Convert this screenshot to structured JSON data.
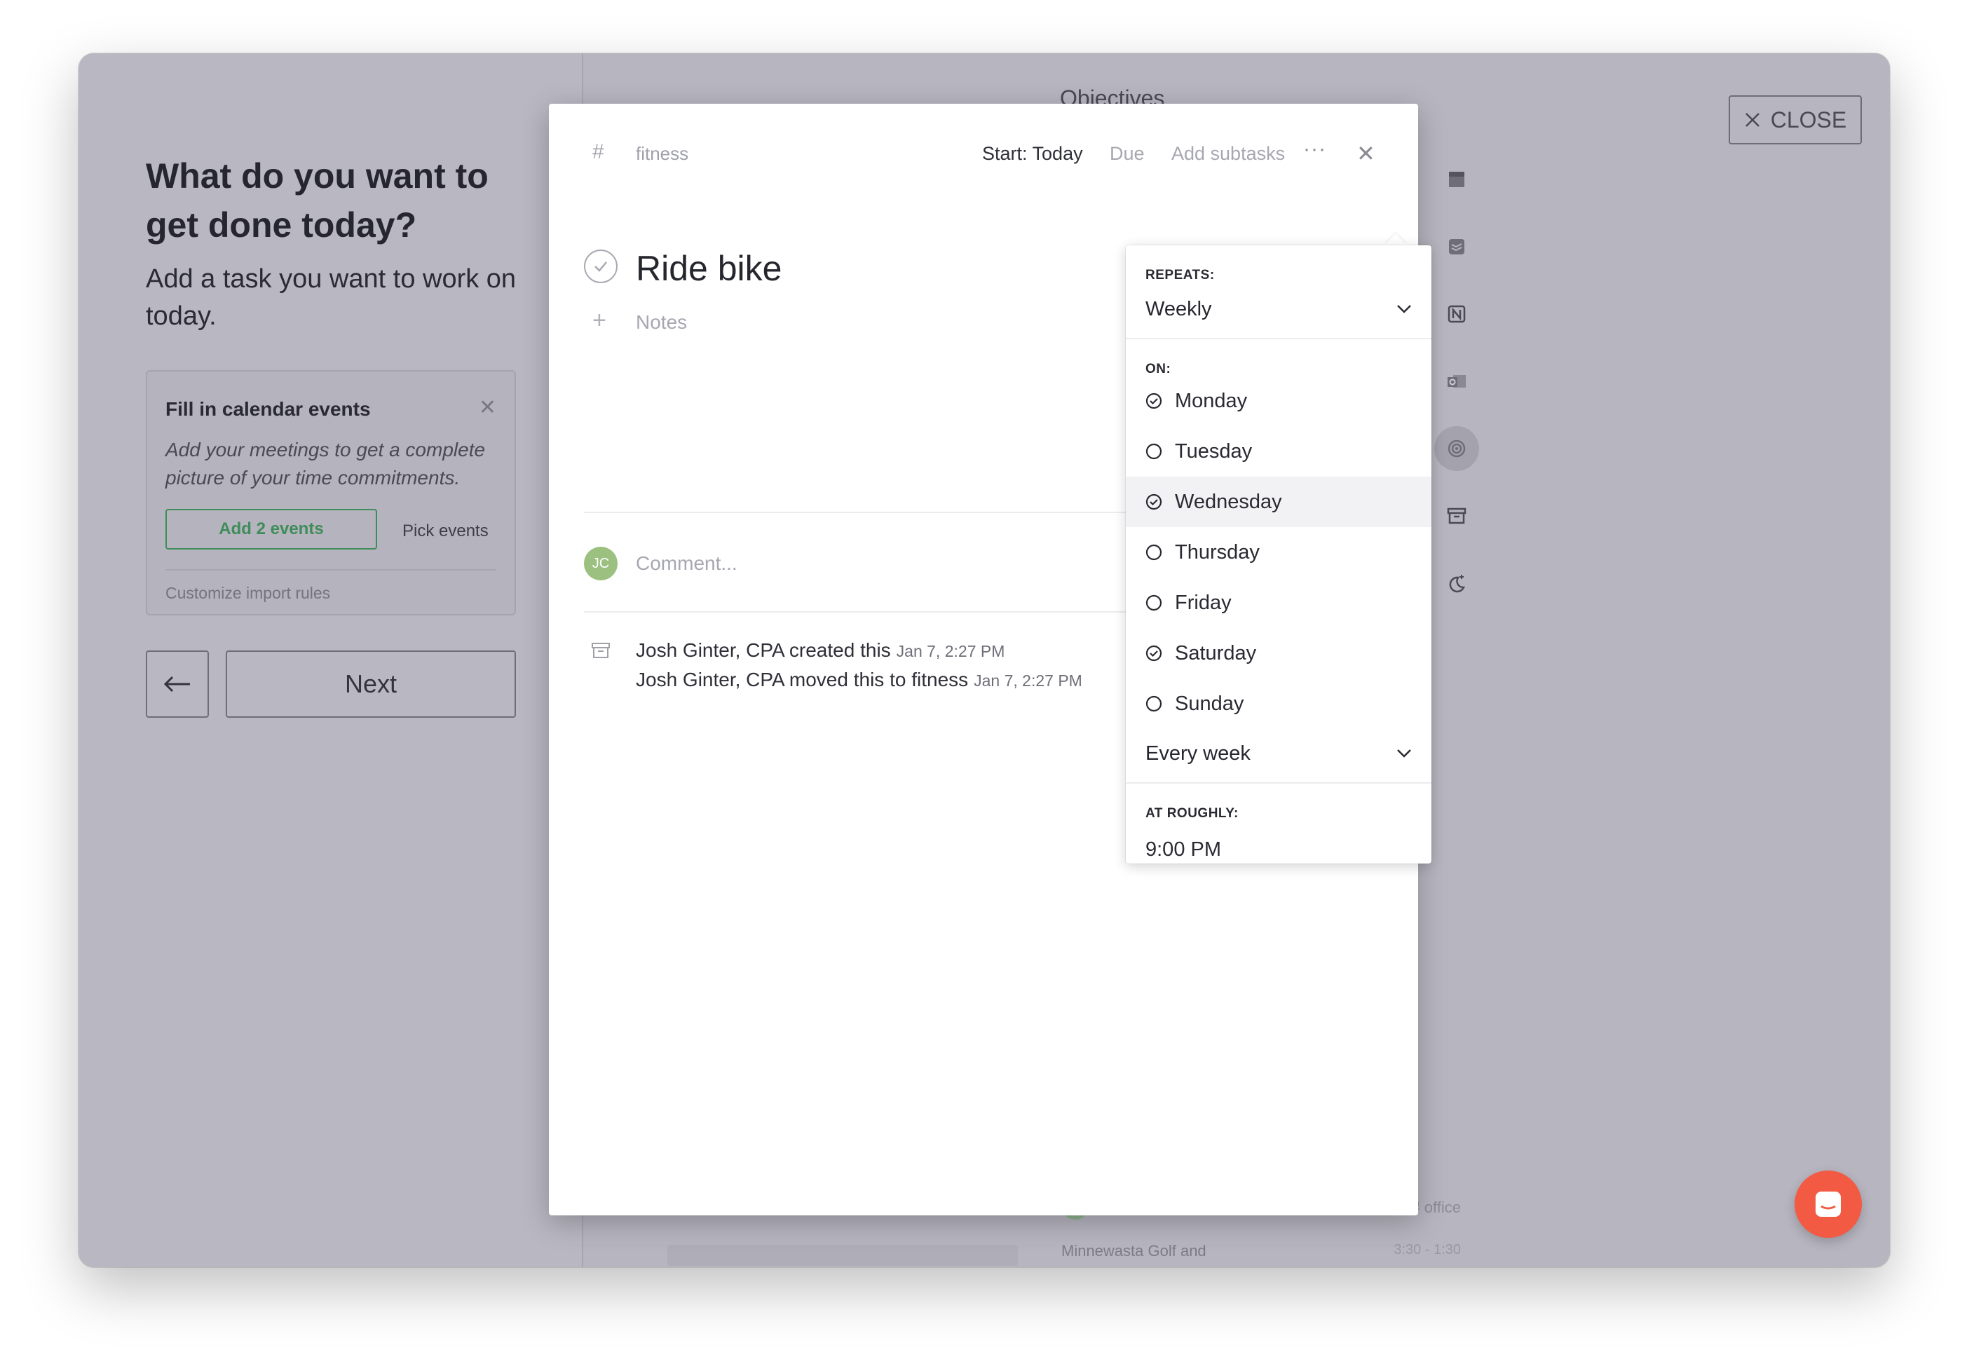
{
  "left": {
    "title": "What do you want to get done today?",
    "subtitle": "Add a task you want to work on today.",
    "calendar_card": {
      "title": "Fill in calendar events",
      "description": "Add your meetings to get a complete picture of your time commitments.",
      "add_events_label": "Add 2 events",
      "pick_events_label": "Pick events",
      "customize_label": "Customize import rules"
    },
    "next_label": "Next"
  },
  "background": {
    "title": "Objectives",
    "close_label": "CLOSE",
    "tag_office": "# office",
    "golf_text": "Minnewasta Golf and",
    "golf_time": "3:30 - 1:30"
  },
  "task": {
    "project": "fitness",
    "start_label": "Start: Today",
    "due_label": "Due",
    "subtasks_label": "Add subtasks",
    "more_label": "···",
    "title": "Ride bike",
    "notes_placeholder": "Notes",
    "comment_placeholder": "Comment...",
    "avatar_initials": "JC",
    "activity": [
      {
        "text": "Josh Ginter, CPA created this",
        "date": "Jan 7, 2:27 PM"
      },
      {
        "text": "Josh Ginter, CPA moved this to fitness",
        "date": "Jan 7, 2:27 PM"
      }
    ]
  },
  "repeat": {
    "repeats_label": "REPEATS:",
    "frequency": "Weekly",
    "on_label": "ON:",
    "days": [
      {
        "name": "Monday",
        "checked": true
      },
      {
        "name": "Tuesday",
        "checked": false
      },
      {
        "name": "Wednesday",
        "checked": true
      },
      {
        "name": "Thursday",
        "checked": false
      },
      {
        "name": "Friday",
        "checked": false
      },
      {
        "name": "Saturday",
        "checked": true
      },
      {
        "name": "Sunday",
        "checked": false
      }
    ],
    "interval": "Every week",
    "at_roughly_label": "AT ROUGHLY:",
    "time": "9:00 PM"
  },
  "colors": {
    "accent_green": "#3f8d5a",
    "chat_bubble": "#f25a44",
    "avatar": "#9cc07f"
  }
}
